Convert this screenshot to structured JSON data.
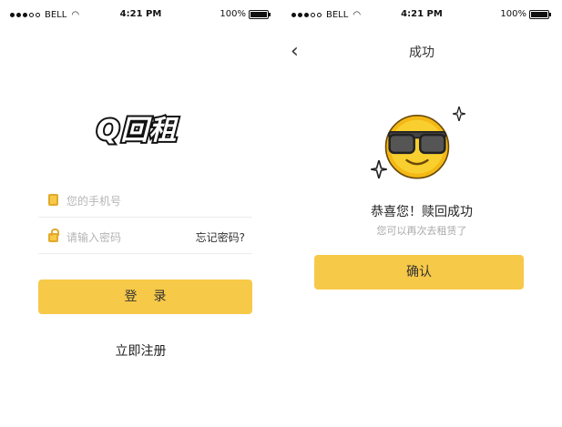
{
  "left_screen": {
    "status": {
      "carrier": "BELL",
      "time": "4:21 PM",
      "battery": "100%",
      "signal_bars_filled": 3,
      "signal_bars_total": 5
    },
    "logo_text": "Q回租",
    "phone_placeholder": "您的手机号",
    "password_placeholder": "请输入密码",
    "forgot_password": "忘记密码?",
    "login_button": "登录",
    "register_link": "立即注册"
  },
  "right_screen": {
    "status": {
      "carrier": "BELL",
      "time": "4:21 PM",
      "battery": "100%",
      "signal_bars_filled": 3,
      "signal_bars_total": 5
    },
    "nav_title": "成功",
    "success_message": "恭喜您！赎回成功",
    "sub_message": "您可以再次去租赁了",
    "confirm_button": "确认"
  },
  "colors": {
    "accent": "#f7c948",
    "text": "#333333",
    "muted": "#b5b5b5"
  }
}
